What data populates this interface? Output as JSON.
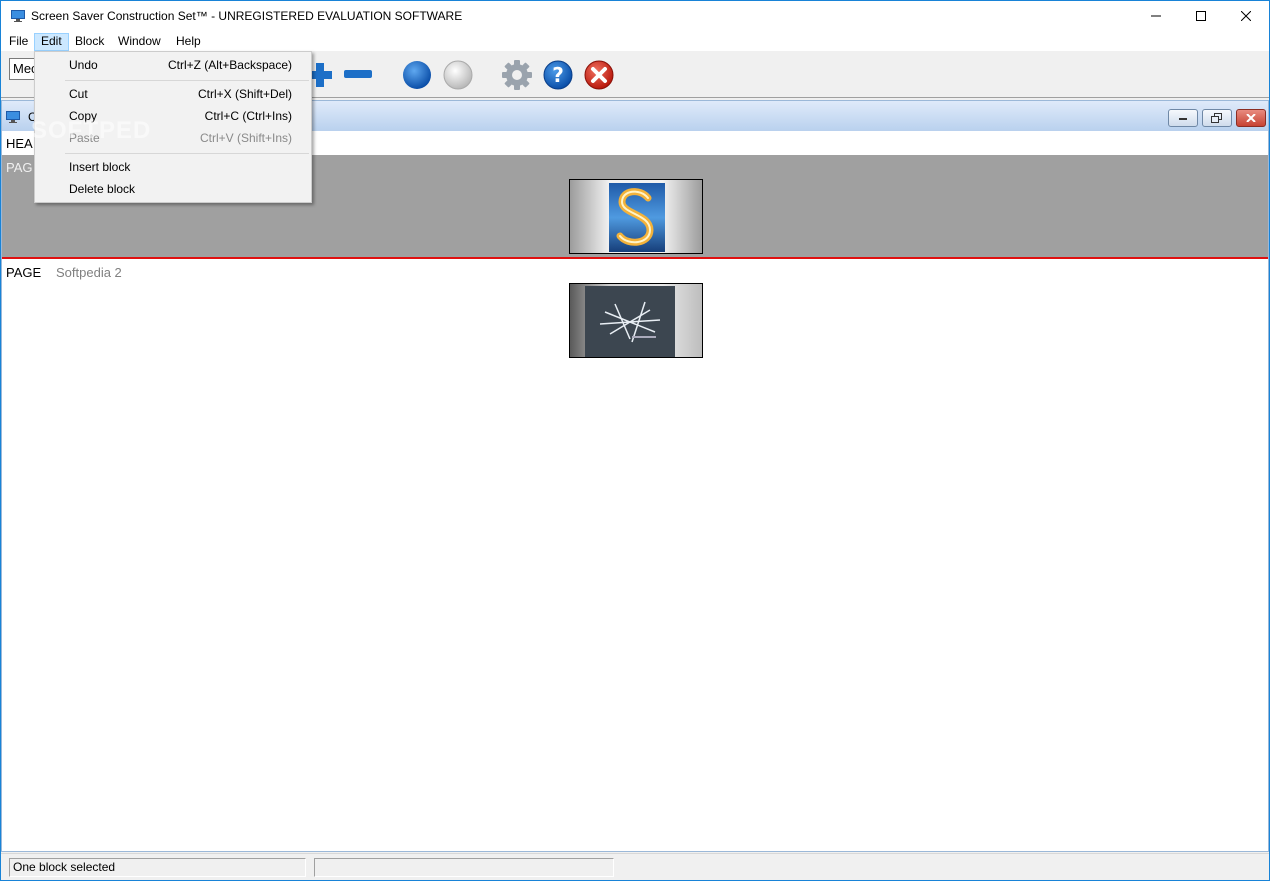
{
  "window": {
    "title": "Screen Saver Construction Set™ - UNREGISTERED EVALUATION SOFTWARE"
  },
  "menubar": {
    "items": [
      {
        "label": "File"
      },
      {
        "label": "Edit"
      },
      {
        "label": "Block"
      },
      {
        "label": "Window"
      },
      {
        "label": "Help"
      }
    ]
  },
  "toolbar": {
    "combo_value": "Mec",
    "icons": [
      "add-icon",
      "remove-icon",
      "blue-circle-icon",
      "white-circle-icon",
      "settings-gear-icon",
      "help-icon",
      "exit-icon"
    ]
  },
  "edit_menu": {
    "items": [
      {
        "label": "Undo",
        "shortcut": "Ctrl+Z (Alt+Backspace)",
        "enabled": true
      },
      {
        "label": "Cut",
        "shortcut": "Ctrl+X (Shift+Del)",
        "enabled": true
      },
      {
        "label": "Copy",
        "shortcut": "Ctrl+C (Ctrl+Ins)",
        "enabled": true
      },
      {
        "label": "Paste",
        "shortcut": "Ctrl+V (Shift+Ins)",
        "enabled": false
      },
      {
        "label": "Insert block",
        "shortcut": "",
        "enabled": true
      },
      {
        "label": "Delete block",
        "shortcut": "",
        "enabled": true
      }
    ]
  },
  "watermark": "SOFTPED",
  "mdi": {
    "title_visible": "C"
  },
  "blocks": {
    "header_label": "HEA",
    "page1_label": "PAG",
    "page2_label": "PAGE",
    "page2_name": "Softpedia 2"
  },
  "statusbar": {
    "panel1": "One block selected",
    "panel2": ""
  },
  "colors": {
    "selected_block_bg": "#a0a0a0",
    "selection_line": "#e01010",
    "menu_active": "#cce8ff"
  }
}
